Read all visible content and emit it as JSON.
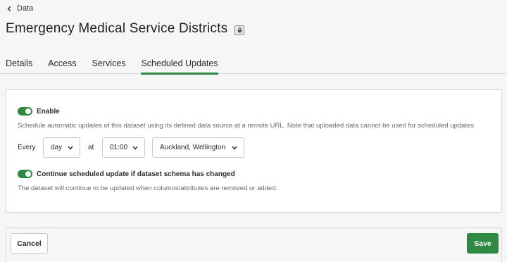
{
  "breadcrumb": {
    "back_label": "Data"
  },
  "page": {
    "title": "Emergency Medical Service Districts"
  },
  "tabs": [
    {
      "label": "Details",
      "active": false
    },
    {
      "label": "Access",
      "active": false
    },
    {
      "label": "Services",
      "active": false
    },
    {
      "label": "Scheduled Updates",
      "active": true
    }
  ],
  "schedule": {
    "enable_label": "Enable",
    "enable_on": true,
    "enable_help": "Schedule automatic updates of this dataset using its defined data source at a remote URL. Note that uploaded data cannot be used for scheduled updates",
    "every_label": "Every",
    "frequency_value": "day",
    "at_label": "at",
    "time_value": "01:00",
    "timezone_value": "Auckland, Wellington",
    "continue_label": "Continue scheduled update if dataset schema has changed",
    "continue_on": true,
    "continue_help": "The dataset will continue to be updated when columns/attributes are removed or added."
  },
  "footer": {
    "cancel_label": "Cancel",
    "save_label": "Save"
  },
  "colors": {
    "accent": "#2e8a42",
    "background": "#f6f6f6"
  }
}
